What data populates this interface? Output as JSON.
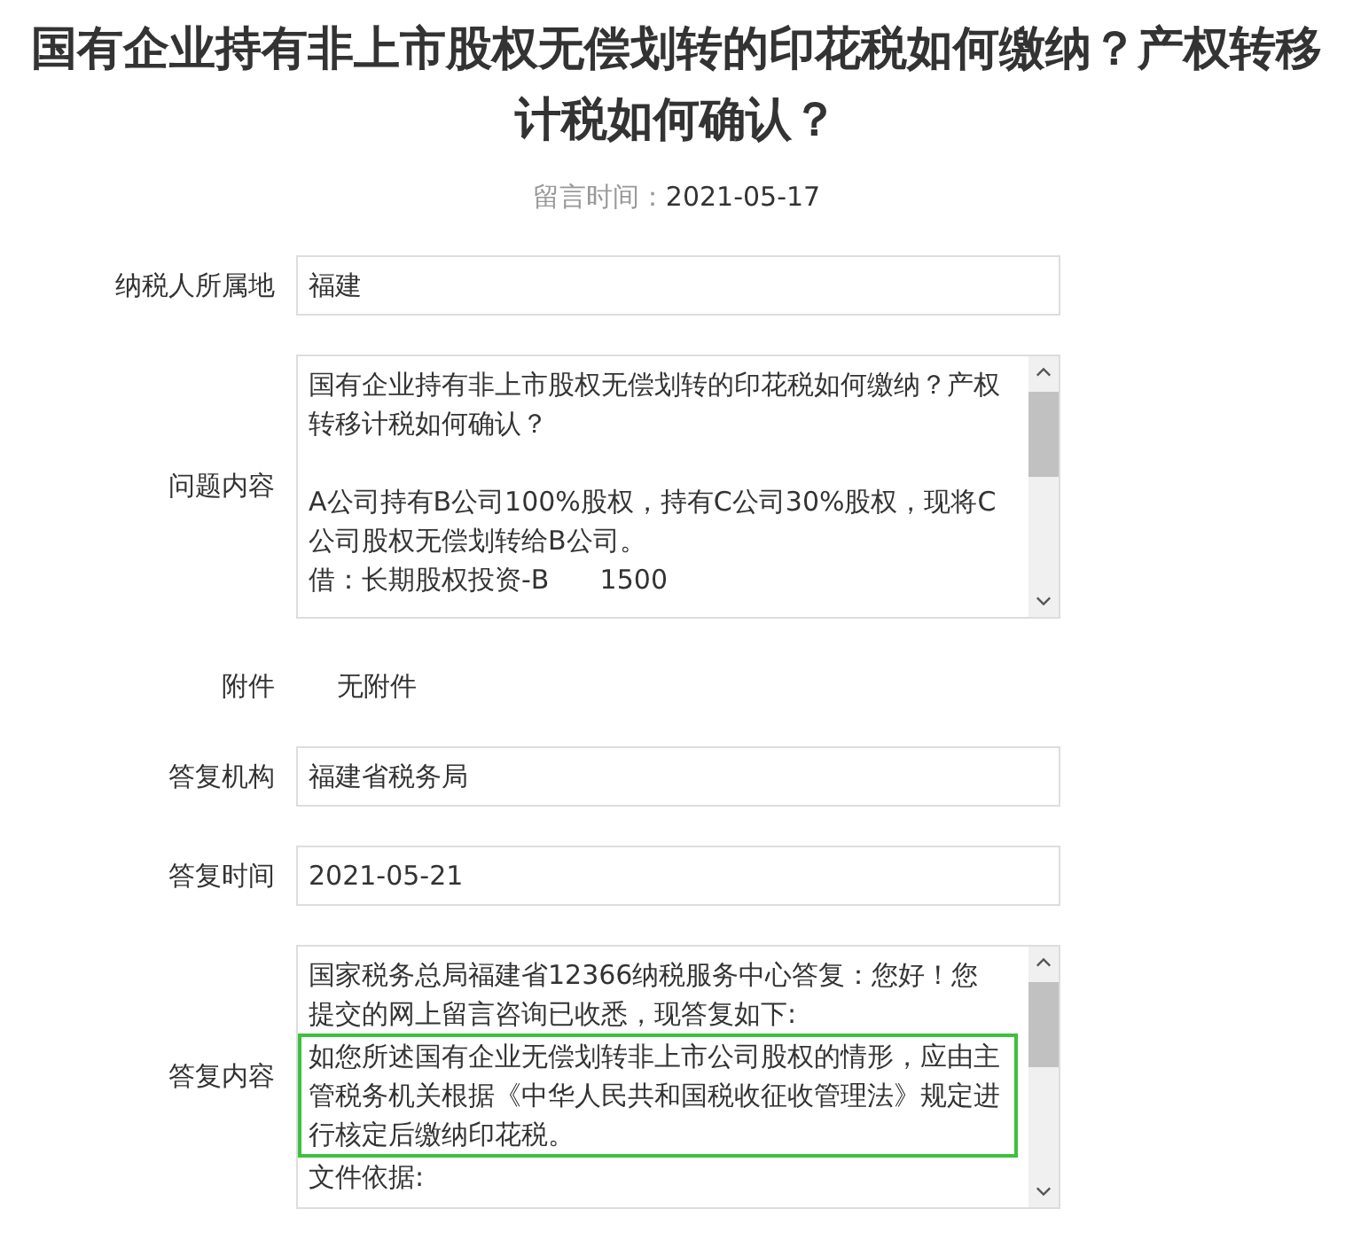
{
  "title": "国有企业持有非上市股权无偿划转的印花税如何缴纳？产权转移计税如何确认？",
  "posted": {
    "label": "留言时间：",
    "value": "2021-05-17"
  },
  "fields": [
    {
      "kind": "input",
      "label": "纳税人所属地",
      "value": "福建"
    },
    {
      "kind": "textarea",
      "label": "问题内容",
      "paragraphs": [
        {
          "text": "国有企业持有非上市股权无偿划转的印花税如何缴纳？产权转移计税如何确认？",
          "blank_before": false,
          "highlighted": false
        },
        {
          "text": "A公司持有B公司100%股权，持有C公司30%股权，现将C公司股权无偿划转给B公司。",
          "blank_before": true,
          "highlighted": false
        },
        {
          "text": "借：长期股权投资-B      1500",
          "blank_before": false,
          "highlighted": false
        }
      ]
    },
    {
      "kind": "plain",
      "label": "附件",
      "value": "无附件"
    },
    {
      "kind": "input",
      "label": "答复机构",
      "value": "福建省税务局"
    },
    {
      "kind": "input",
      "label": "答复时间",
      "value": "2021-05-21"
    },
    {
      "kind": "textarea",
      "label": "答复内容",
      "paragraphs": [
        {
          "text": "国家税务总局福建省12366纳税服务中心答复：您好！您提交的网上留言咨询已收悉，现答复如下:",
          "blank_before": false,
          "highlighted": false
        },
        {
          "text": "如您所述国有企业无偿划转非上市公司股权的情形，应由主管税务机关根据《中华人民共和国税收征收管理法》规定进行核定后缴纳印花税。",
          "blank_before": false,
          "highlighted": true
        },
        {
          "text": "文件依据:",
          "blank_before": false,
          "highlighted": false
        }
      ]
    }
  ]
}
